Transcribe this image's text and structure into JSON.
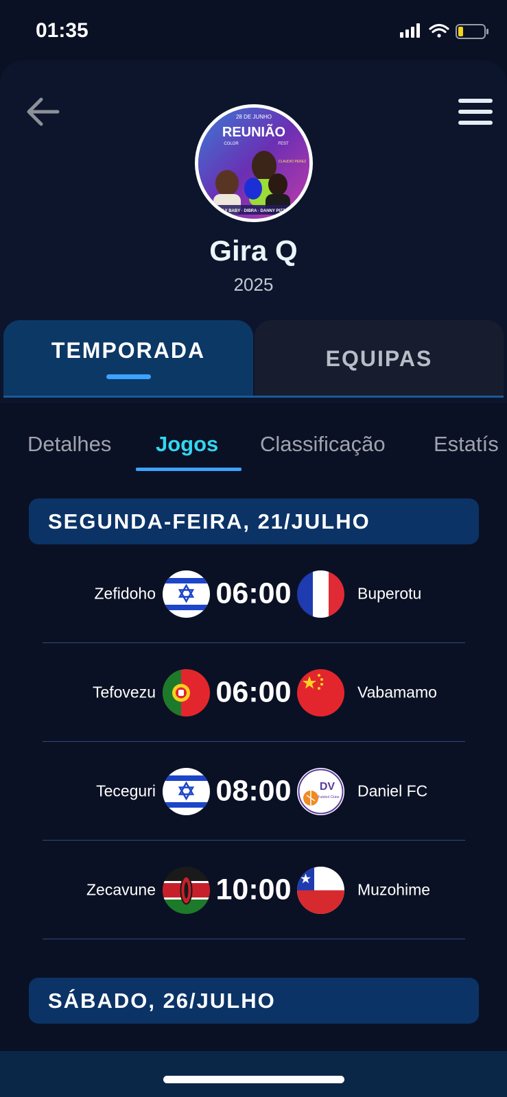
{
  "status_bar": {
    "time": "01:35"
  },
  "header": {
    "title": "Gira Q",
    "year": "2025"
  },
  "poster": {
    "date": "28 DE JUNHO",
    "title": "REUNIÃO",
    "subtitle_left": "COLOR",
    "subtitle_right": "FEST",
    "artist_right": "CLAUDIO PEREZ",
    "lineup": "ELY BABY · DIBRA · DANNY PIZZY"
  },
  "main_tabs": [
    {
      "label": "TEMPORADA"
    },
    {
      "label": "EQUIPAS"
    }
  ],
  "sub_tabs": [
    {
      "label": "Detalhes"
    },
    {
      "label": "Jogos"
    },
    {
      "label": "Classificação"
    },
    {
      "label": "Estatís"
    }
  ],
  "days": [
    {
      "label": "SEGUNDA-FEIRA, 21/JULHO",
      "matches": [
        {
          "home": "Zefidoho",
          "home_flag": "israel-flag",
          "time": "06:00",
          "away": "Buperotu",
          "away_flag": "france-flag"
        },
        {
          "home": "Tefovezu",
          "home_flag": "portugal-flag",
          "time": "06:00",
          "away": "Vabamamo",
          "away_flag": "china-flag"
        },
        {
          "home": "Teceguri",
          "home_flag": "israel-flag",
          "time": "08:00",
          "away": "Daniel FC",
          "away_flag": "daniel-fc-logo"
        },
        {
          "home": "Zecavune",
          "home_flag": "kenya-flag",
          "time": "10:00",
          "away": "Muzohime",
          "away_flag": "chile-flag"
        }
      ]
    },
    {
      "label": "SÁBADO, 26/JULHO"
    }
  ],
  "daniel_fc_logo": {
    "initials": "DV",
    "caption": "Futebol Clube"
  },
  "colors": {
    "background": "#0b1124",
    "accent": "#3ea2ff",
    "active_subtab": "#33d6f0",
    "day_header": "#0b3366",
    "active_tab": "#0c3866"
  }
}
